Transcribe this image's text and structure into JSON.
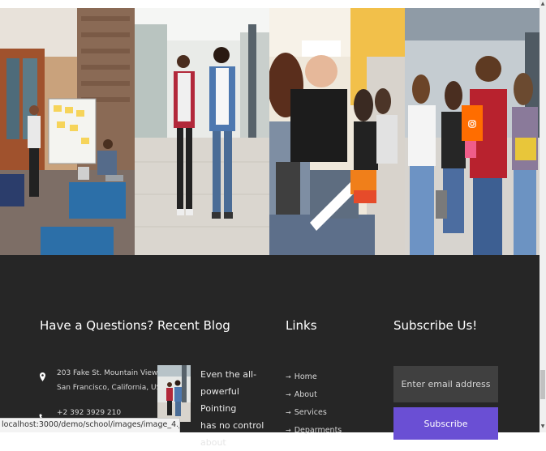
{
  "gallery": {
    "images": [
      {
        "name": "gallery-image-office"
      },
      {
        "name": "gallery-image-walking-students"
      },
      {
        "name": "gallery-image-studying-students"
      },
      {
        "name": "gallery-image-group-students"
      }
    ],
    "badge_icon": "instagram-icon",
    "badge_color": "#ff6d00"
  },
  "footer": {
    "questions": {
      "title": "Have a Questions?",
      "address_line1": "203 Fake St. Mountain View,",
      "address_line2": "San Francisco, California, USA",
      "phone": "+2 392 3929 210",
      "address_icon": "map-pin-icon",
      "phone_icon": "phone-icon"
    },
    "blog": {
      "title": "Recent Blog",
      "post_lines": [
        "Even the all-",
        "powerful Pointing",
        "has no control",
        "about"
      ]
    },
    "links": {
      "title": "Links",
      "items": [
        "Home",
        "About",
        "Services",
        "Deparments"
      ]
    },
    "subscribe": {
      "title": "Subscribe Us!",
      "email_placeholder": "Enter email address",
      "button_label": "Subscribe",
      "button_color": "#6a4fd4"
    }
  },
  "browser": {
    "status_url": "localhost:3000/demo/school/images/image_4.jpg"
  }
}
